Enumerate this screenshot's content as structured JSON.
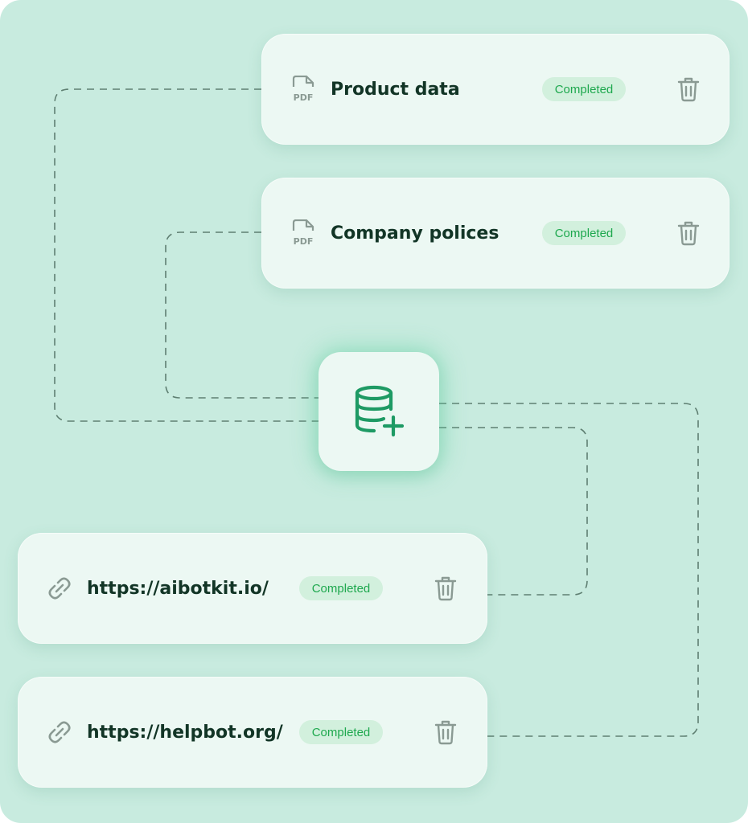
{
  "sources": [
    {
      "type": "pdf",
      "icon": "pdf-file-icon",
      "title": "Product data",
      "status": "Completed"
    },
    {
      "type": "pdf",
      "icon": "pdf-file-icon",
      "title": "Company polices",
      "status": "Completed"
    },
    {
      "type": "link",
      "icon": "link-icon",
      "title": "https://aibotkit.io/",
      "status": "Completed"
    },
    {
      "type": "link",
      "icon": "link-icon",
      "title": "https://helpbot.org/",
      "status": "Completed"
    }
  ],
  "pdf_icon_label": "PDF",
  "hub": {
    "icon": "database-add-icon"
  },
  "colors": {
    "background": "#c8ebdf",
    "card": "#ecf8f3",
    "accent": "#1ea84e",
    "hub_icon": "#1e9a64",
    "text": "#123526",
    "muted_icon": "#8a9a93"
  }
}
